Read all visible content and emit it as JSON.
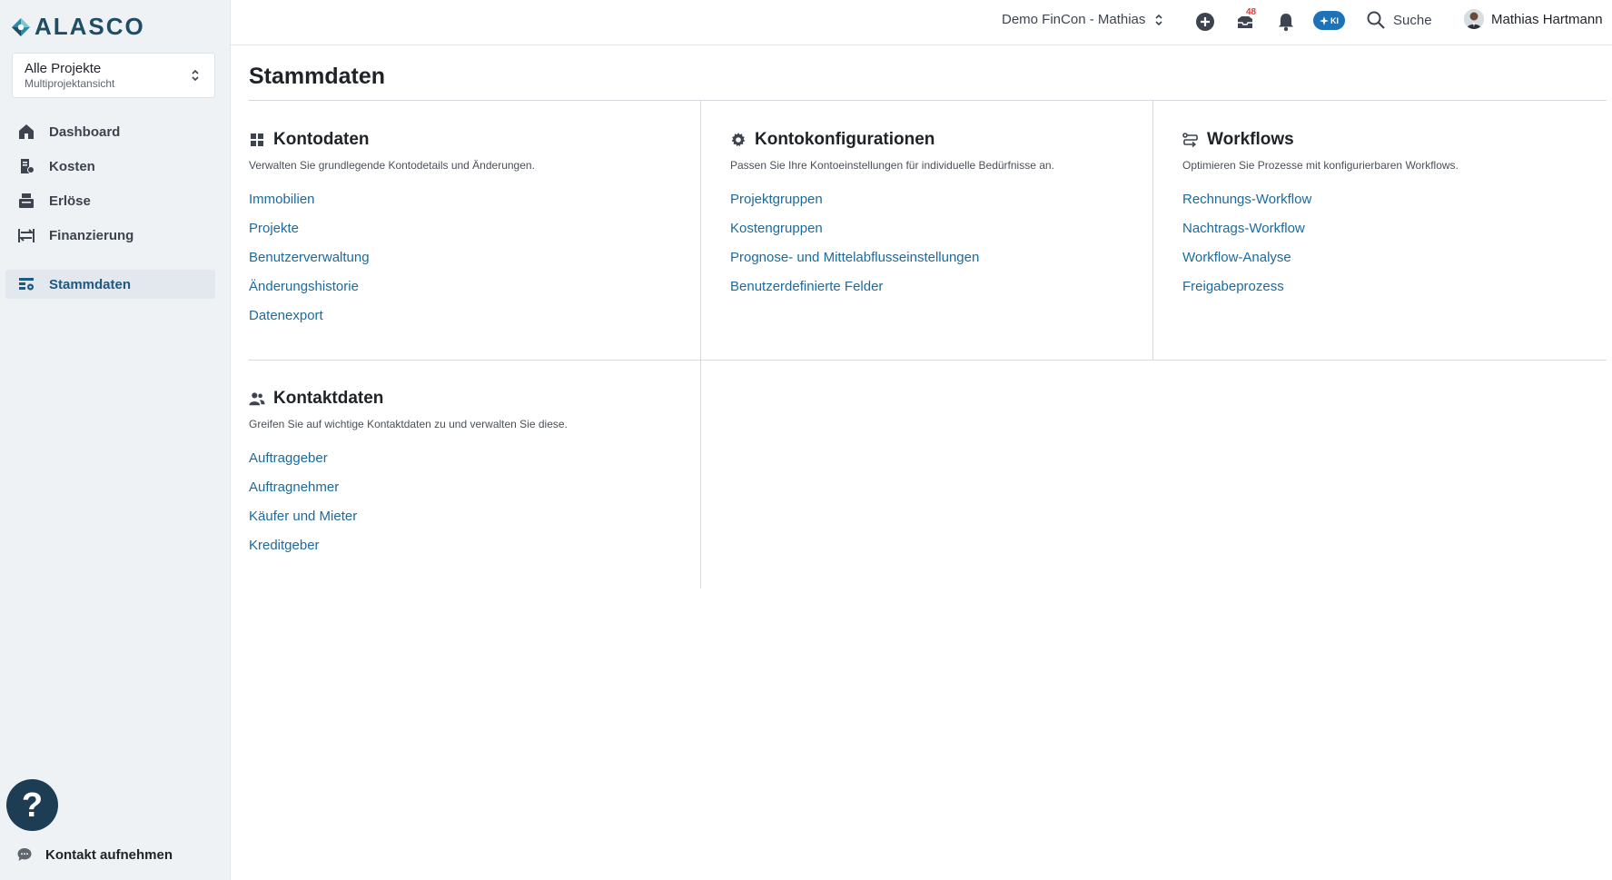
{
  "brand": {
    "name": "ALASCO"
  },
  "project_selector": {
    "title": "Alle Projekte",
    "subtitle": "Multiprojektansicht"
  },
  "sidebar": {
    "items": [
      {
        "label": "Dashboard",
        "icon": "home-icon"
      },
      {
        "label": "Kosten",
        "icon": "receipt-icon"
      },
      {
        "label": "Erlöse",
        "icon": "cash-register-icon"
      },
      {
        "label": "Finanzierung",
        "icon": "exchange-icon"
      },
      {
        "label": "Stammdaten",
        "icon": "settings-table-icon",
        "active": true
      }
    ],
    "contact_label": "Kontakt aufnehmen",
    "help_symbol": "?"
  },
  "header": {
    "account": "Demo FinCon - Mathias",
    "inbox_count": "48",
    "ki_label": "KI",
    "search_label": "Suche",
    "user_name": "Mathias Hartmann"
  },
  "main": {
    "title": "Stammdaten",
    "sections": [
      {
        "title": "Kontodaten",
        "icon": "grid-icon",
        "description": "Verwalten Sie grundlegende Kontodetails und Änderungen.",
        "links": [
          "Immobilien",
          "Projekte",
          "Benutzerverwaltung",
          "Änderungshistorie",
          "Datenexport"
        ]
      },
      {
        "title": "Kontokonfigurationen",
        "icon": "gear-icon",
        "description": "Passen Sie Ihre Kontoeinstellungen für individuelle Bedürfnisse an.",
        "links": [
          "Projektgruppen",
          "Kostengruppen",
          "Prognose- und Mittelabflusseinstellungen",
          "Benutzerdefinierte Felder"
        ]
      },
      {
        "title": "Workflows",
        "icon": "workflow-icon",
        "description": "Optimieren Sie Prozesse mit konfigurierbaren Workflows.",
        "links": [
          "Rechnungs-Workflow",
          "Nachtrags-Workflow",
          "Workflow-Analyse",
          "Freigabeprozess"
        ]
      },
      {
        "title": "Kontaktdaten",
        "icon": "contacts-icon",
        "description": "Greifen Sie auf wichtige Kontaktdaten zu und verwalten Sie diese.",
        "links": [
          "Auftraggeber",
          "Auftragnehmer",
          "Käufer und Mieter",
          "Kreditgeber"
        ]
      }
    ]
  },
  "colors": {
    "accent": "#1d6a9c",
    "sidebar_bg": "#eff2f5",
    "brand": "#1f4d63",
    "ki": "#1d72b8",
    "help": "#1d3d54"
  }
}
